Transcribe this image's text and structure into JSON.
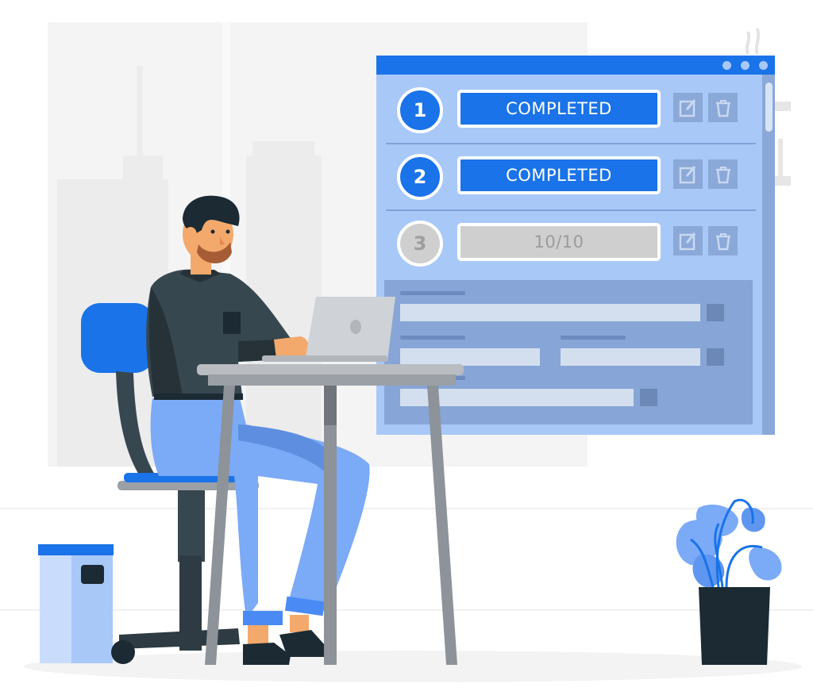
{
  "window": {
    "title_dots": [
      "minimize",
      "maximize",
      "close"
    ],
    "colors": {
      "accent": "#1a73e8",
      "window_bg": "#a8c8f8",
      "pending": "#cfcfcf",
      "form_bg": "#87a5d6"
    },
    "tasks": [
      {
        "number": "1",
        "status": "COMPLETED",
        "state": "done"
      },
      {
        "number": "2",
        "status": "COMPLETED",
        "state": "done"
      },
      {
        "number": "3",
        "status": "10/10",
        "state": "pending"
      }
    ],
    "task_actions": {
      "edit_icon": "edit-icon",
      "delete_icon": "trash-icon"
    },
    "form": {
      "fields": [
        "field-1",
        "field-2",
        "field-3",
        "field-4"
      ]
    }
  },
  "scene": {
    "subject": "man working at laptop on desk",
    "objects": [
      "office-chair",
      "desk",
      "laptop",
      "wastebasket",
      "potted-plant",
      "city-skyline"
    ]
  }
}
